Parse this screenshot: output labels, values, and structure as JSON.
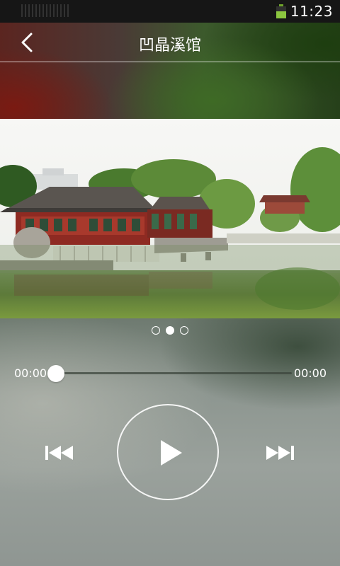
{
  "status_bar": {
    "time": "11:23",
    "battery_level": 0.6
  },
  "header": {
    "title": "凹晶溪馆"
  },
  "carousel": {
    "page_count": 3,
    "active_index": 1
  },
  "player": {
    "elapsed": "00:00",
    "duration": "00:00",
    "progress": 0
  },
  "icons": {
    "back": "chevron-left-icon",
    "previous": "skip-previous-icon",
    "play": "play-icon",
    "next": "skip-next-icon",
    "battery": "battery-icon"
  },
  "colors": {
    "battery_green": "#8cc63f",
    "text": "#ffffff"
  }
}
